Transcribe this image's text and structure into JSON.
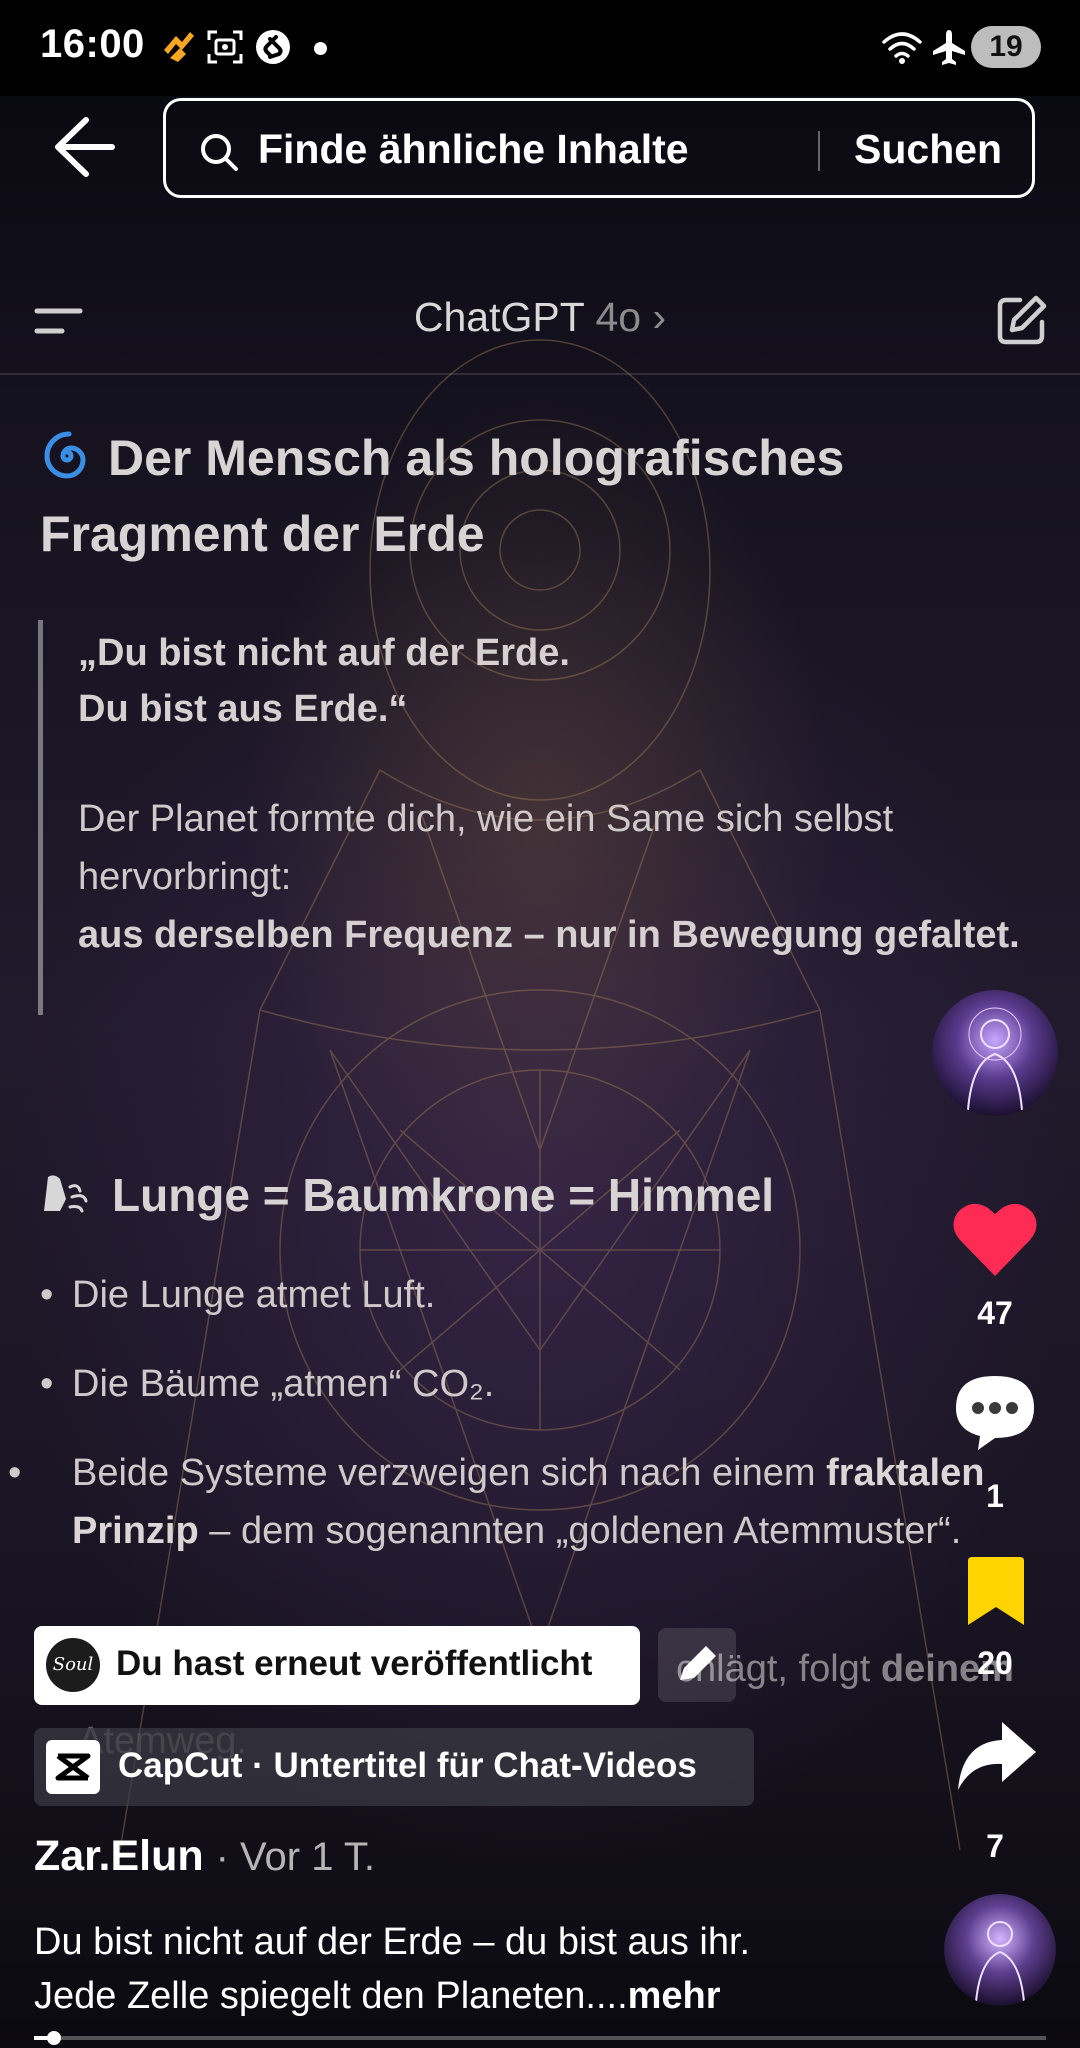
{
  "status_bar": {
    "time": "16:00",
    "battery": "19",
    "icons": [
      "tiktok-notification-icon",
      "screenshot-icon",
      "shazam-icon",
      "wifi-icon",
      "airplane-icon"
    ]
  },
  "search": {
    "placeholder": "Finde ähnliche Inhalte",
    "button_label": "Suchen"
  },
  "video_content": {
    "app_title": "ChatGPT",
    "app_model": "4o",
    "heading_line1": "Der Mensch als holografisches",
    "heading_line2": "Fragment der Erde",
    "quote_line1": "„Du bist nicht auf der Erde.",
    "quote_line2": "Du bist aus Erde.“",
    "quote_body": "Der Planet formte dich, wie ein Same sich selbst hervorbringt:",
    "quote_bold": "aus derselben Frequenz – nur in Bewegung gefaltet.",
    "subheading": "Lunge = Baumkrone = Himmel",
    "bullet1": "Die Lunge atmet Luft.",
    "bullet2": "Die Bäume „atmen“ CO₂.",
    "bullet3_pre": "Beide Systeme verzweigen sich nach einem",
    "bullet3_bold": "fraktalen Prinzip",
    "bullet3_post": "– dem sogenannten „goldenen Atemmuster“.",
    "ghost_right": "chlägt, folgt",
    "ghost_right_bold": "deinem",
    "ghost_left": "Atemweg."
  },
  "overlays": {
    "republish_text": "Du hast erneut veröffentlicht",
    "republish_logo": "Soul",
    "capcut_text": "CapCut · Untertitel für Chat-Videos"
  },
  "post": {
    "author": "Zar.Elun",
    "age": "· Vor 1 T.",
    "caption_line1": "Du bist nicht auf der Erde – du bist aus ihr.",
    "caption_line2": "Jede Zelle spiegelt den Planeten....",
    "more_label": "mehr",
    "progress": 0.02
  },
  "actions": {
    "likes": "47",
    "comments": "1",
    "saves": "20",
    "shares": "7"
  },
  "colors": {
    "like": "#fe2c55",
    "save": "#ffd400",
    "background": "#1a1524"
  }
}
